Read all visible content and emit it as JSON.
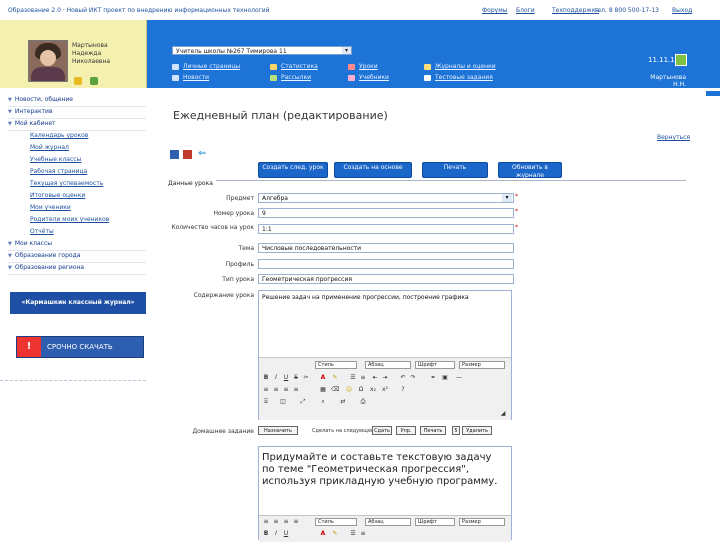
{
  "topbar": {
    "title_text": "Образование 2.0 · Новый ИКТ проект по внедрению информационных технологий",
    "links": [
      "Форумы",
      "Блоги",
      "Техподдержка",
      "Выход"
    ],
    "phone_text": "тел. 8 800 500-17-13"
  },
  "user": {
    "name_line1": "Мартынова",
    "name_line2": "Надежда",
    "name_line3": "Николаевна"
  },
  "header": {
    "class_select": "Учитель школы №267 Тимирова 11",
    "links": [
      "Личные страницы",
      "Статистика",
      "Уроки",
      "Журналы и оценки",
      "Новости",
      "Рассылки",
      "Учебники",
      "Тестовые задания"
    ],
    "date": "11.11.11",
    "user_link": "Мартынова Н.Н. настройки"
  },
  "sidebar": {
    "sections": [
      {
        "label": "Новости, общение"
      },
      {
        "label": "Интерактив"
      },
      {
        "label": "Мой кабинет"
      }
    ],
    "items": [
      "Календарь уроков",
      "Мой журнал",
      "Учебные классы",
      "Рабочая страница",
      "Текущая успеваемость",
      "Итоговые оценки",
      "Мои ученики",
      "Родители моих учеников",
      "Отчёты"
    ],
    "sections2": [
      {
        "label": "Мои классы"
      },
      {
        "label": "Образование города"
      },
      {
        "label": "Образование региона"
      }
    ],
    "banner": "«Кармашкин классный журнал»",
    "download_label": "СРОЧНО СКАЧАТЬ"
  },
  "page": {
    "title": "Ежедневный план (редактирование)",
    "right_link": "Вернуться",
    "buttons": [
      "Создать след. урок",
      "Создать на основе",
      "Печать",
      "Обновить в журнале"
    ],
    "section_title": "Данные урока",
    "fields": [
      {
        "label": "Предмет",
        "value": "Алгебра"
      },
      {
        "label": "Номер урока",
        "value": "9"
      },
      {
        "label": "Количество часов на урок",
        "value": "1:1"
      },
      {
        "label": "Тема",
        "value": "Числовые последовательности"
      },
      {
        "label": "Профиль",
        "value": ""
      },
      {
        "label": "Тип урока",
        "value": "Геометрическая прогрессия"
      }
    ],
    "content_label": "Содержание урока",
    "content_text": "Решение задач на применение прогрессии, построение графика",
    "homework_label": "Домашнее задание",
    "homework_button": "Назначить",
    "homework_mid_label": "Сделать на следующем",
    "homework_mini": [
      "Сдать",
      "Упр.",
      "Печать",
      "5",
      "Удалить"
    ],
    "homework_text": "Придумайте и составьте текстовую задачу по теме \"Геометрическая прогрессия\", используя прикладную учебную программу."
  },
  "editor": {
    "style_select": "Стиль",
    "format_select": "Абзац",
    "font_select": "Шрифт",
    "size_select": "Размер"
  }
}
